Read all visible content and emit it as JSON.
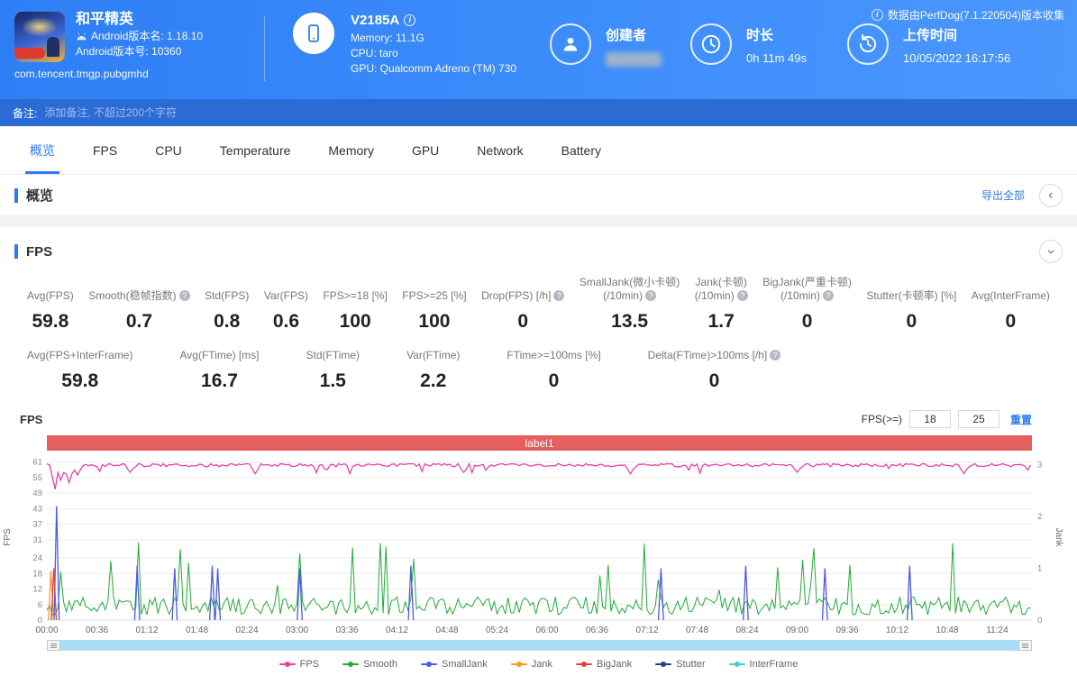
{
  "header": {
    "app": {
      "title": "和平精英",
      "version_name": "Android版本名: 1.18.10",
      "version_code": "Android版本号: 10360",
      "package": "com.tencent.tmgp.pubgmhd"
    },
    "device": {
      "name": "V2185A",
      "memory": "Memory: 11.1G",
      "cpu": "CPU: taro",
      "gpu": "GPU: Qualcomm Adreno (TM) 730"
    },
    "creator": {
      "label": "创建者"
    },
    "duration": {
      "label": "时长",
      "value": "0h 11m 49s"
    },
    "upload": {
      "label": "上传时间",
      "value": "10/05/2022 16:17:56"
    },
    "collect_note": "数据由PerfDog(7.1.220504)版本收集"
  },
  "remarks": {
    "label": "备注:",
    "placeholder": "添加备注, 不超过200个字符"
  },
  "tabs": {
    "active_index": 0,
    "items": [
      "概览",
      "FPS",
      "CPU",
      "Temperature",
      "Memory",
      "GPU",
      "Network",
      "Battery"
    ]
  },
  "overview": {
    "title": "概览",
    "export_all": "导出全部"
  },
  "fps_section": {
    "title": "FPS",
    "metrics_row1": [
      {
        "label": "Avg(FPS)",
        "value": "59.8"
      },
      {
        "label": "Smooth(稳帧指数)",
        "help": true,
        "value": "0.7"
      },
      {
        "label": "Std(FPS)",
        "value": "0.8"
      },
      {
        "label": "Var(FPS)",
        "value": "0.6"
      },
      {
        "label": "FPS>=18 [%]",
        "value": "100"
      },
      {
        "label": "FPS>=25 [%]",
        "value": "100"
      },
      {
        "label": "Drop(FPS) [/h]",
        "help": true,
        "value": "0"
      },
      {
        "label": "SmallJank(微小卡顿)",
        "label2": "(/10min)",
        "help": true,
        "value": "13.5"
      },
      {
        "label": "Jank(卡顿)",
        "label2": "(/10min)",
        "help": true,
        "value": "1.7"
      },
      {
        "label": "BigJank(严重卡顿)",
        "label2": "(/10min)",
        "help": true,
        "value": "0"
      },
      {
        "label": "Stutter(卡顿率) [%]",
        "value": "0"
      },
      {
        "label": "Avg(InterFrame)",
        "value": "0"
      }
    ],
    "metrics_row2": [
      {
        "label": "Avg(FPS+InterFrame)",
        "value": "59.8"
      },
      {
        "label": "Avg(FTime) [ms]",
        "value": "16.7"
      },
      {
        "label": "Std(FTime)",
        "value": "1.5"
      },
      {
        "label": "Var(FTime)",
        "value": "2.2"
      },
      {
        "label": "FTime>=100ms [%]",
        "value": "0"
      },
      {
        "label": "Delta(FTime)>100ms [/h]",
        "help": true,
        "value": "0"
      }
    ],
    "controls": {
      "label": "FPS(>=)",
      "min": "18",
      "max": "25",
      "reset": "重置"
    },
    "chart_axis_label": "FPS"
  },
  "chart_data": {
    "type": "line",
    "banner_label": "label1",
    "duration_s": 709,
    "x_ticks": [
      "00:00",
      "00:36",
      "01:12",
      "01:48",
      "02:24",
      "03:00",
      "03:36",
      "04:12",
      "04:48",
      "05:24",
      "06:00",
      "06:36",
      "07:12",
      "07:48",
      "08:24",
      "09:00",
      "09:36",
      "10:12",
      "10:48",
      "11:24"
    ],
    "y_left": {
      "label": "FPS",
      "ticks": [
        0,
        6,
        12,
        18,
        24,
        31,
        37,
        43,
        49,
        55,
        61
      ],
      "max": 64
    },
    "y_right": {
      "label": "Jank",
      "ticks": [
        0,
        1,
        2,
        3
      ],
      "max": 3.2
    },
    "series": {
      "fps": {
        "color": "#e743a1",
        "baseline": 59.8,
        "dips": [
          [
            6,
            50.5
          ],
          [
            10,
            54
          ],
          [
            16,
            53
          ],
          [
            22,
            56
          ],
          [
            60,
            57
          ],
          [
            150,
            56.5
          ],
          [
            300,
            57
          ],
          [
            420,
            56.5
          ],
          [
            540,
            57
          ],
          [
            660,
            56.5
          ]
        ]
      },
      "smooth": {
        "color": "#22ac38",
        "baseline": 0.5
      },
      "smalljank": {
        "color": "#4e59e8",
        "spikes": [
          [
            7,
            2.2
          ],
          [
            65,
            1.05
          ],
          [
            92,
            1.0
          ],
          [
            119,
            1.05
          ],
          [
            123,
            1.0
          ],
          [
            182,
            1.0
          ],
          [
            262,
            1.05
          ],
          [
            442,
            1.0
          ],
          [
            503,
            1.05
          ],
          [
            560,
            1.0
          ],
          [
            621,
            1.05
          ]
        ]
      },
      "jank": {
        "color": "#f59b22",
        "spikes": [
          [
            3,
            0.95
          ]
        ]
      },
      "bigjank": {
        "color": "#e04343",
        "spikes": [
          [
            5,
            1.0
          ]
        ]
      },
      "stutter": {
        "color": "#2b3a8f",
        "spikes": []
      },
      "interframe": {
        "color": "#3ed0cf",
        "spikes": []
      }
    },
    "legend": [
      {
        "label": "FPS",
        "color": "#e743a1"
      },
      {
        "label": "Smooth",
        "color": "#22ac38"
      },
      {
        "label": "SmallJank",
        "color": "#4e59e8"
      },
      {
        "label": "Jank",
        "color": "#f59b22"
      },
      {
        "label": "BigJank",
        "color": "#e04343"
      },
      {
        "label": "Stutter",
        "color": "#2b3a8f"
      },
      {
        "label": "InterFrame",
        "color": "#3ed0cf"
      }
    ]
  }
}
